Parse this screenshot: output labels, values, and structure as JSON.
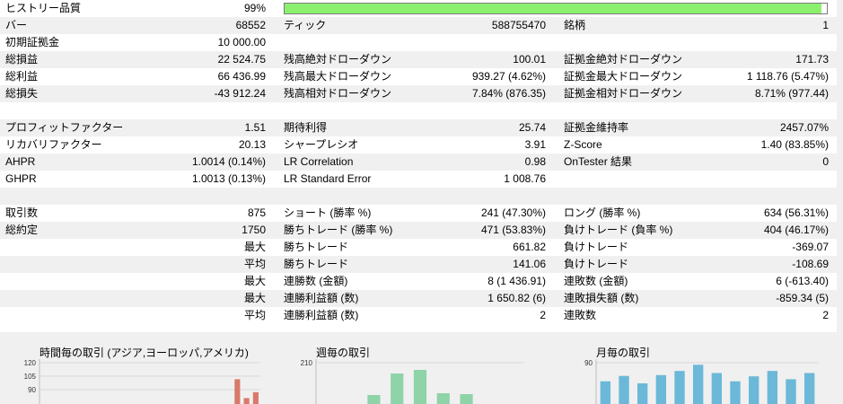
{
  "rows": {
    "history_quality": {
      "label": "ヒストリー品質",
      "value": "99%",
      "progress": 0.99,
      "progress_color": "#8cf06e"
    },
    "bars": {
      "label": "バー",
      "value": "68552"
    },
    "ticks": {
      "label": "ティック",
      "value": "588755470"
    },
    "symbols": {
      "label": "銘柄",
      "value": "1"
    },
    "initial_deposit": {
      "label": "初期証拠金",
      "value": "10 000.00"
    },
    "total_net_profit": {
      "label": "総損益",
      "value": "22 524.75"
    },
    "balance_dd_absolute": {
      "label": "残高絶対ドローダウン",
      "value": "100.01"
    },
    "equity_dd_absolute": {
      "label": "証拠金絶対ドローダウン",
      "value": "171.73"
    },
    "gross_profit": {
      "label": "総利益",
      "value": "66 436.99"
    },
    "balance_dd_maximal": {
      "label": "残高最大ドローダウン",
      "value": "939.27 (4.62%)"
    },
    "equity_dd_maximal": {
      "label": "証拠金最大ドローダウン",
      "value": "1 118.76 (5.47%)"
    },
    "gross_loss": {
      "label": "総損失",
      "value": "-43 912.24"
    },
    "balance_dd_relative": {
      "label": "残高相対ドローダウン",
      "value": "7.84% (876.35)"
    },
    "equity_dd_relative": {
      "label": "証拠金相対ドローダウン",
      "value": "8.71% (977.44)"
    },
    "profit_factor": {
      "label": "プロフィットファクター",
      "value": "1.51"
    },
    "expected_payoff": {
      "label": "期待利得",
      "value": "25.74"
    },
    "margin_level": {
      "label": "証拠金維持率",
      "value": "2457.07%"
    },
    "recovery_factor": {
      "label": "リカバリファクター",
      "value": "20.13"
    },
    "sharpe_ratio": {
      "label": "シャープレシオ",
      "value": "3.91"
    },
    "z_score": {
      "label": "Z-Score",
      "value": "1.40 (83.85%)"
    },
    "ahpr": {
      "label": "AHPR",
      "value": "1.0014 (0.14%)"
    },
    "lr_correlation": {
      "label": "LR Correlation",
      "value": "0.98"
    },
    "ontester_result": {
      "label": "OnTester 結果",
      "value": "0"
    },
    "ghpr": {
      "label": "GHPR",
      "value": "1.0013 (0.13%)"
    },
    "lr_standard_error": {
      "label": "LR Standard Error",
      "value": "1 008.76"
    },
    "total_trades": {
      "label": "取引数",
      "value": "875"
    },
    "short_trades": {
      "label": "ショート (勝率 %)",
      "value": "241 (47.30%)"
    },
    "long_trades": {
      "label": "ロング (勝率 %)",
      "value": "634 (56.31%)"
    },
    "total_deals": {
      "label": "総約定",
      "value": "1750"
    },
    "profit_trades": {
      "label": "勝ちトレード (勝率 %)",
      "value": "471 (53.83%)"
    },
    "loss_trades": {
      "label": "負けトレード (負率 %)",
      "value": "404 (46.17%)"
    },
    "largest_profit": {
      "sublabel": "最大",
      "label": "勝ちトレード",
      "value": "661.82"
    },
    "largest_loss": {
      "label": "負けトレード",
      "value": "-369.07"
    },
    "average_profit": {
      "sublabel": "平均",
      "label": "勝ちトレード",
      "value": "141.06"
    },
    "average_loss": {
      "label": "負けトレード",
      "value": "-108.69"
    },
    "max_consecutive_wins": {
      "sublabel": "最大",
      "label": "連勝数 (金額)",
      "value": "8 (1 436.91)"
    },
    "max_consecutive_losses": {
      "label": "連敗数 (金額)",
      "value": "6 (-613.40)"
    },
    "max_consecutive_profit": {
      "sublabel": "最大",
      "label": "連勝利益額 (数)",
      "value": "1 650.82 (6)"
    },
    "max_consecutive_loss": {
      "label": "連敗損失額 (数)",
      "value": "-859.34 (5)"
    },
    "avg_consecutive_wins": {
      "sublabel": "平均",
      "label": "連勝利益額 (数)",
      "value": "2"
    },
    "avg_consecutive_losses": {
      "label": "連敗数",
      "value": "2"
    }
  },
  "chart_data": [
    {
      "type": "bar",
      "title": "時間毎の取引 (アジア,ヨーロッパ,アメリカ)",
      "yticks": [
        "120",
        "105",
        "90"
      ],
      "ylim": [
        85,
        120
      ],
      "color": "#d9796a",
      "categories": [
        "",
        "",
        "",
        "",
        "",
        "",
        "",
        "",
        "",
        "",
        "",
        "",
        "",
        "",
        "",
        "",
        "",
        "",
        "",
        "",
        "",
        "",
        "",
        ""
      ],
      "values": [
        0,
        0,
        0,
        0,
        0,
        0,
        0,
        0,
        0,
        0,
        0,
        0,
        0,
        0,
        0,
        0,
        0,
        0,
        0,
        0,
        0,
        106,
        90,
        95
      ]
    },
    {
      "type": "bar",
      "title": "週毎の取引",
      "yticks": [
        "210"
      ],
      "ylim": [
        0,
        230
      ],
      "color": "#8fd3a8",
      "categories": [
        "",
        "",
        "",
        "",
        "",
        "",
        "",
        "",
        ""
      ],
      "values": [
        0,
        0,
        50,
        170,
        190,
        60,
        55,
        0,
        0
      ]
    },
    {
      "type": "bar",
      "title": "月毎の取引",
      "yticks": [
        "90"
      ],
      "ylim": [
        0,
        100
      ],
      "color": "#6cb8d8",
      "categories": [
        "",
        "",
        "",
        "",
        "",
        "",
        "",
        "",
        "",
        "",
        "",
        ""
      ],
      "values": [
        55,
        68,
        50,
        70,
        80,
        95,
        75,
        55,
        67,
        80,
        60,
        75
      ]
    }
  ]
}
